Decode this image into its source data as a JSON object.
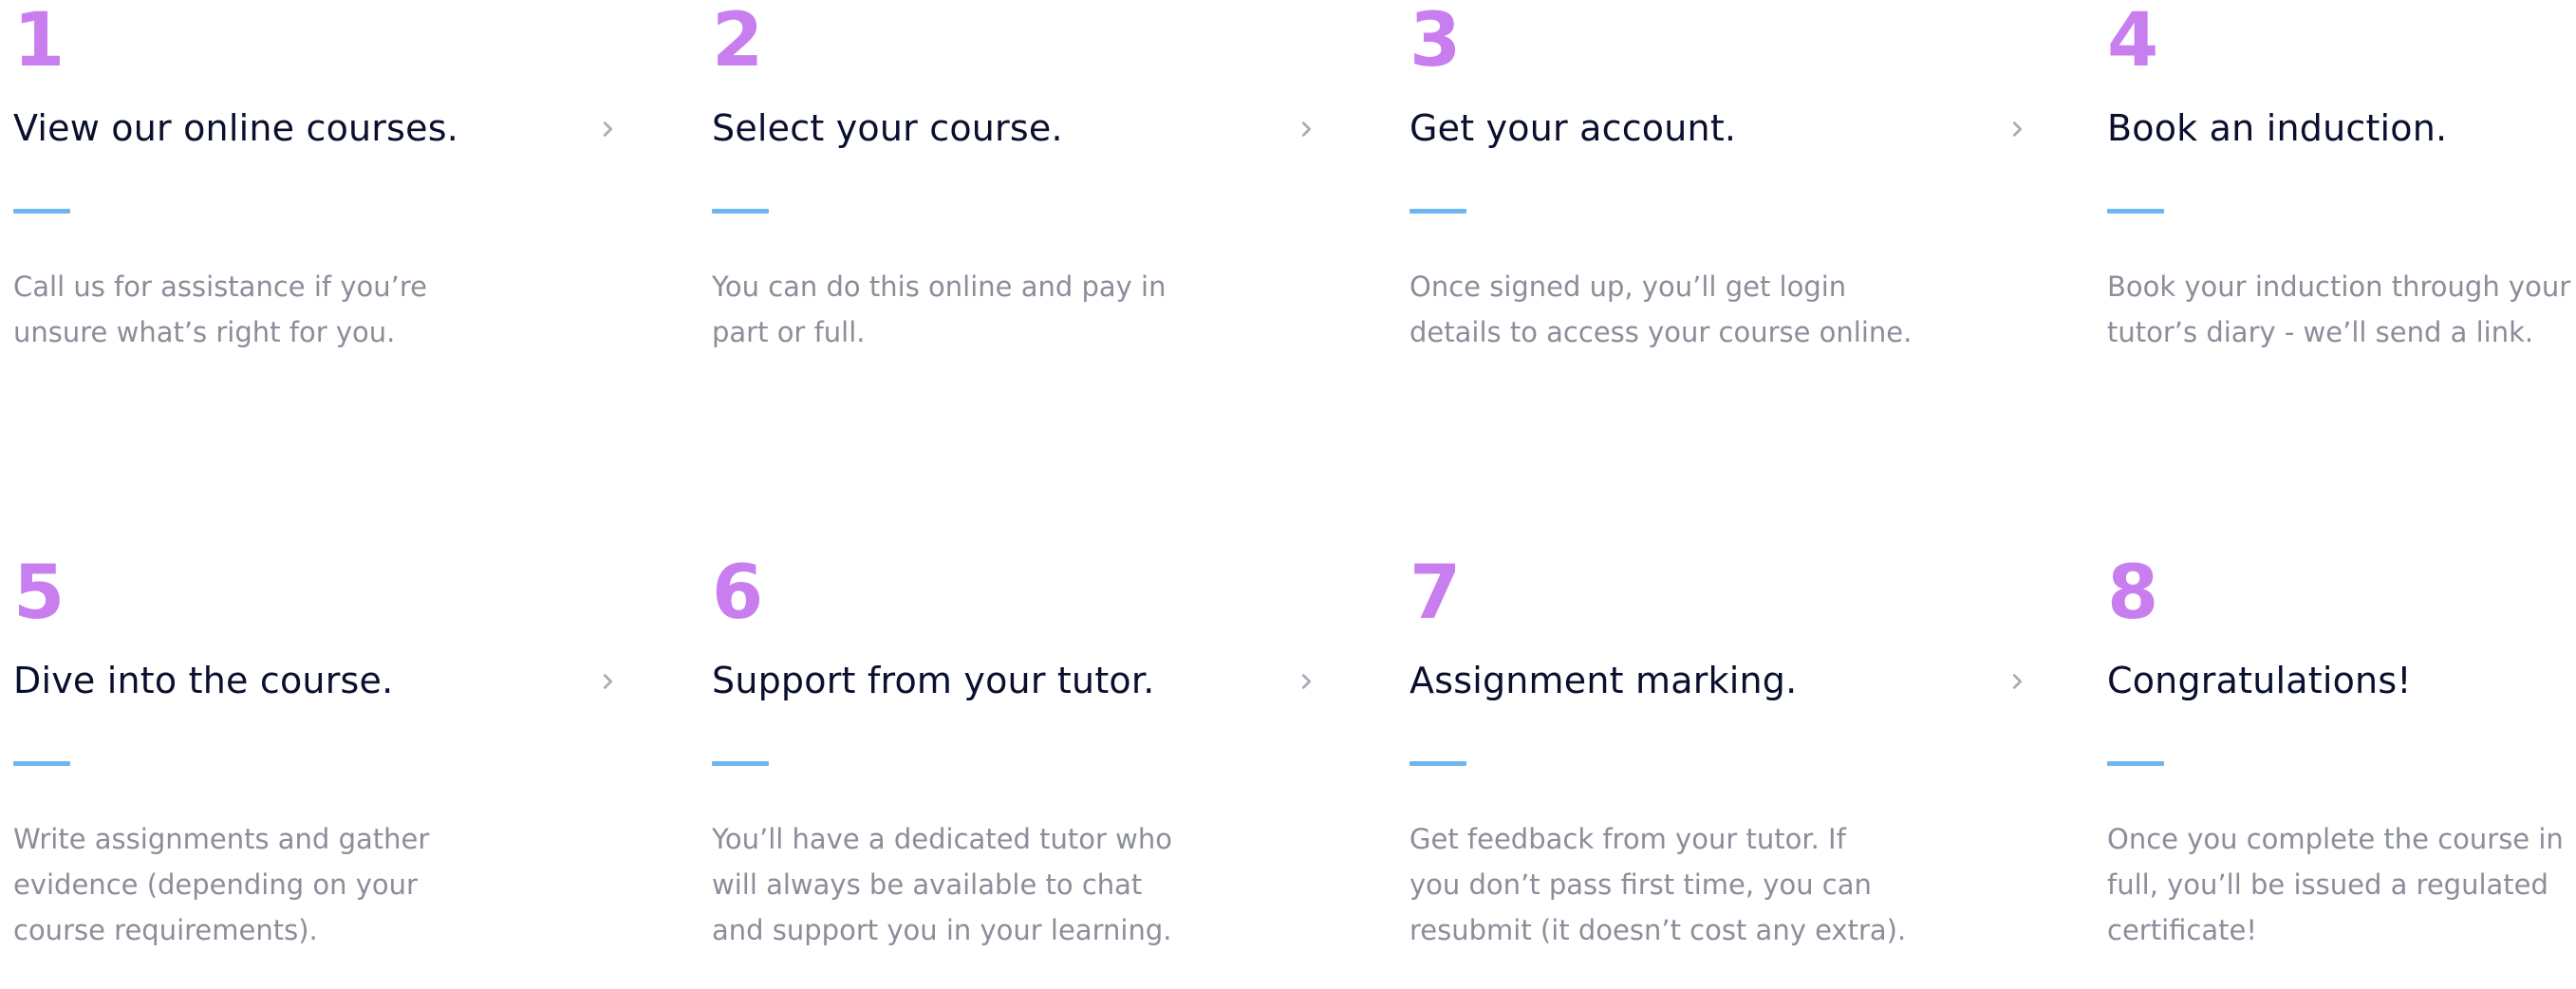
{
  "steps": [
    {
      "number": "1",
      "title": "View our online courses.",
      "has_arrow": true,
      "description_lines": [
        "Call us for assistance if you’re",
        "unsure what’s right for you."
      ]
    },
    {
      "number": "2",
      "title": "Select your course.",
      "has_arrow": true,
      "description_lines": [
        "You can do this online and pay in",
        "part or full."
      ]
    },
    {
      "number": "3",
      "title": "Get your account.",
      "has_arrow": true,
      "description_lines": [
        "Once signed up, you’ll get login",
        "details to access your course online."
      ]
    },
    {
      "number": "4",
      "title": "Book an induction.",
      "has_arrow": false,
      "description_lines": [
        "Book your induction through your",
        "tutor’s diary - we’ll send a link."
      ]
    },
    {
      "number": "5",
      "title": "Dive into the course.",
      "has_arrow": true,
      "description_lines": [
        "Write assignments and gather",
        "evidence (depending on your",
        "course requirements)."
      ]
    },
    {
      "number": "6",
      "title": "Support from your tutor.",
      "has_arrow": true,
      "description_lines": [
        "You’ll have a dedicated tutor who",
        "will always be available to chat",
        "and support you in your learning."
      ]
    },
    {
      "number": "7",
      "title": "Assignment marking.",
      "has_arrow": true,
      "description_lines": [
        "Get feedback from your tutor. If",
        "you don’t pass first time, you can",
        "resubmit (it doesn’t cost  any extra)."
      ]
    },
    {
      "number": "8",
      "title": "Congratulations!",
      "has_arrow": false,
      "description_lines": [
        "Once you complete the course in",
        "full, you’ll be issued a regulated",
        "certificate!"
      ]
    }
  ],
  "colors": {
    "number": "#c97ef0",
    "title": "#0a0f2e",
    "accent_line": "#6fb6ee",
    "description": "#8b8e99",
    "arrow": "#a8acb8"
  },
  "icons": {
    "arrow": "chevron-right-icon"
  }
}
